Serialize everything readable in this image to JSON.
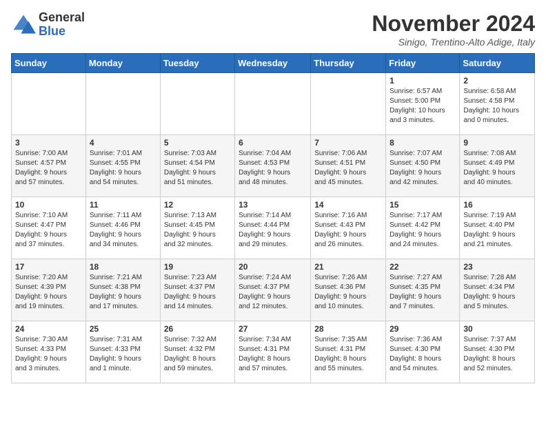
{
  "header": {
    "logo_general": "General",
    "logo_blue": "Blue",
    "month_title": "November 2024",
    "location": "Sinigo, Trentino-Alto Adige, Italy"
  },
  "days_of_week": [
    "Sunday",
    "Monday",
    "Tuesday",
    "Wednesday",
    "Thursday",
    "Friday",
    "Saturday"
  ],
  "weeks": [
    [
      {
        "day": "",
        "info": ""
      },
      {
        "day": "",
        "info": ""
      },
      {
        "day": "",
        "info": ""
      },
      {
        "day": "",
        "info": ""
      },
      {
        "day": "",
        "info": ""
      },
      {
        "day": "1",
        "info": "Sunrise: 6:57 AM\nSunset: 5:00 PM\nDaylight: 10 hours\nand 3 minutes."
      },
      {
        "day": "2",
        "info": "Sunrise: 6:58 AM\nSunset: 4:58 PM\nDaylight: 10 hours\nand 0 minutes."
      }
    ],
    [
      {
        "day": "3",
        "info": "Sunrise: 7:00 AM\nSunset: 4:57 PM\nDaylight: 9 hours\nand 57 minutes."
      },
      {
        "day": "4",
        "info": "Sunrise: 7:01 AM\nSunset: 4:55 PM\nDaylight: 9 hours\nand 54 minutes."
      },
      {
        "day": "5",
        "info": "Sunrise: 7:03 AM\nSunset: 4:54 PM\nDaylight: 9 hours\nand 51 minutes."
      },
      {
        "day": "6",
        "info": "Sunrise: 7:04 AM\nSunset: 4:53 PM\nDaylight: 9 hours\nand 48 minutes."
      },
      {
        "day": "7",
        "info": "Sunrise: 7:06 AM\nSunset: 4:51 PM\nDaylight: 9 hours\nand 45 minutes."
      },
      {
        "day": "8",
        "info": "Sunrise: 7:07 AM\nSunset: 4:50 PM\nDaylight: 9 hours\nand 42 minutes."
      },
      {
        "day": "9",
        "info": "Sunrise: 7:08 AM\nSunset: 4:49 PM\nDaylight: 9 hours\nand 40 minutes."
      }
    ],
    [
      {
        "day": "10",
        "info": "Sunrise: 7:10 AM\nSunset: 4:47 PM\nDaylight: 9 hours\nand 37 minutes."
      },
      {
        "day": "11",
        "info": "Sunrise: 7:11 AM\nSunset: 4:46 PM\nDaylight: 9 hours\nand 34 minutes."
      },
      {
        "day": "12",
        "info": "Sunrise: 7:13 AM\nSunset: 4:45 PM\nDaylight: 9 hours\nand 32 minutes."
      },
      {
        "day": "13",
        "info": "Sunrise: 7:14 AM\nSunset: 4:44 PM\nDaylight: 9 hours\nand 29 minutes."
      },
      {
        "day": "14",
        "info": "Sunrise: 7:16 AM\nSunset: 4:43 PM\nDaylight: 9 hours\nand 26 minutes."
      },
      {
        "day": "15",
        "info": "Sunrise: 7:17 AM\nSunset: 4:42 PM\nDaylight: 9 hours\nand 24 minutes."
      },
      {
        "day": "16",
        "info": "Sunrise: 7:19 AM\nSunset: 4:40 PM\nDaylight: 9 hours\nand 21 minutes."
      }
    ],
    [
      {
        "day": "17",
        "info": "Sunrise: 7:20 AM\nSunset: 4:39 PM\nDaylight: 9 hours\nand 19 minutes."
      },
      {
        "day": "18",
        "info": "Sunrise: 7:21 AM\nSunset: 4:38 PM\nDaylight: 9 hours\nand 17 minutes."
      },
      {
        "day": "19",
        "info": "Sunrise: 7:23 AM\nSunset: 4:37 PM\nDaylight: 9 hours\nand 14 minutes."
      },
      {
        "day": "20",
        "info": "Sunrise: 7:24 AM\nSunset: 4:37 PM\nDaylight: 9 hours\nand 12 minutes."
      },
      {
        "day": "21",
        "info": "Sunrise: 7:26 AM\nSunset: 4:36 PM\nDaylight: 9 hours\nand 10 minutes."
      },
      {
        "day": "22",
        "info": "Sunrise: 7:27 AM\nSunset: 4:35 PM\nDaylight: 9 hours\nand 7 minutes."
      },
      {
        "day": "23",
        "info": "Sunrise: 7:28 AM\nSunset: 4:34 PM\nDaylight: 9 hours\nand 5 minutes."
      }
    ],
    [
      {
        "day": "24",
        "info": "Sunrise: 7:30 AM\nSunset: 4:33 PM\nDaylight: 9 hours\nand 3 minutes."
      },
      {
        "day": "25",
        "info": "Sunrise: 7:31 AM\nSunset: 4:33 PM\nDaylight: 9 hours\nand 1 minute."
      },
      {
        "day": "26",
        "info": "Sunrise: 7:32 AM\nSunset: 4:32 PM\nDaylight: 8 hours\nand 59 minutes."
      },
      {
        "day": "27",
        "info": "Sunrise: 7:34 AM\nSunset: 4:31 PM\nDaylight: 8 hours\nand 57 minutes."
      },
      {
        "day": "28",
        "info": "Sunrise: 7:35 AM\nSunset: 4:31 PM\nDaylight: 8 hours\nand 55 minutes."
      },
      {
        "day": "29",
        "info": "Sunrise: 7:36 AM\nSunset: 4:30 PM\nDaylight: 8 hours\nand 54 minutes."
      },
      {
        "day": "30",
        "info": "Sunrise: 7:37 AM\nSunset: 4:30 PM\nDaylight: 8 hours\nand 52 minutes."
      }
    ]
  ]
}
